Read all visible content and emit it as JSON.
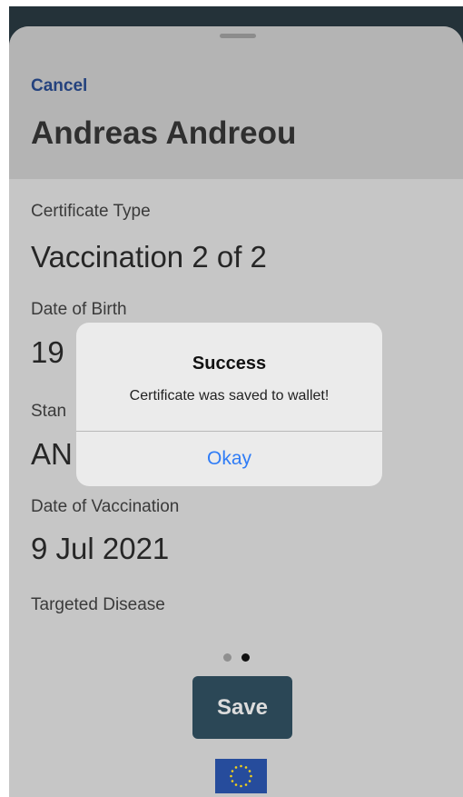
{
  "sheet": {
    "cancel_label": "Cancel",
    "holder_name": "Andreas Andreou"
  },
  "certificate": {
    "fields": [
      {
        "label": "Certificate Type",
        "value": "Vaccination 2 of 2"
      },
      {
        "label": "Date of Birth",
        "value": "19"
      },
      {
        "label": "Stan",
        "value": "AN"
      },
      {
        "label": "Date of Vaccination",
        "value": "9 Jul 2021"
      },
      {
        "label": "Targeted Disease",
        "value": ""
      }
    ]
  },
  "pager": {
    "page_count": 2,
    "current_page": 2
  },
  "actions": {
    "save_label": "Save"
  },
  "footer": {
    "flag_icon": "eu-flag-icon"
  },
  "alert": {
    "title": "Success",
    "message": "Certificate was saved to wallet!",
    "ok_label": "Okay"
  },
  "colors": {
    "link_blue": "#24427e",
    "alert_button_blue": "#2f7cf6",
    "save_button_bg": "#2b4756",
    "eu_blue": "#264c9c",
    "eu_star": "#f4d21a"
  }
}
